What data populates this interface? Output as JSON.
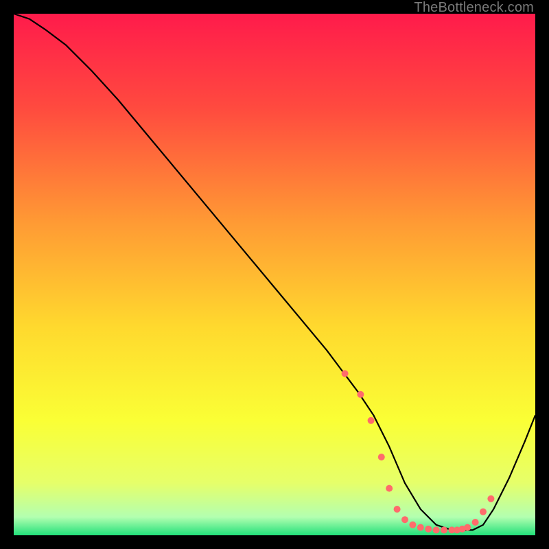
{
  "watermark": "TheBottleneck.com",
  "chart_data": {
    "type": "line",
    "title": "",
    "xlabel": "",
    "ylabel": "",
    "xlim": [
      0,
      100
    ],
    "ylim": [
      0,
      100
    ],
    "grid": false,
    "background_gradient": {
      "stops": [
        {
          "offset": 0.0,
          "color": "#ff1b4b"
        },
        {
          "offset": 0.18,
          "color": "#ff4a3f"
        },
        {
          "offset": 0.4,
          "color": "#ff9a34"
        },
        {
          "offset": 0.6,
          "color": "#ffd92e"
        },
        {
          "offset": 0.78,
          "color": "#faff35"
        },
        {
          "offset": 0.9,
          "color": "#e6ff6a"
        },
        {
          "offset": 0.965,
          "color": "#b3ffb0"
        },
        {
          "offset": 1.0,
          "color": "#22e07a"
        }
      ]
    },
    "series": [
      {
        "name": "bottleneck-curve",
        "color": "#000000",
        "x": [
          0,
          3,
          6,
          10,
          15,
          20,
          25,
          30,
          35,
          40,
          45,
          50,
          55,
          60,
          63,
          66,
          69,
          72,
          75,
          78,
          81,
          84,
          86,
          88,
          90,
          92,
          95,
          98,
          100
        ],
        "y": [
          100,
          99,
          97,
          94,
          89,
          83.5,
          77.5,
          71.5,
          65.5,
          59.5,
          53.5,
          47.5,
          41.5,
          35.5,
          31.5,
          27.5,
          23,
          17,
          10,
          5,
          2,
          1,
          1,
          1,
          2,
          5,
          11,
          18,
          23
        ]
      }
    ],
    "markers": {
      "name": "highlight-dots",
      "color": "#ff6b6b",
      "radius": 5,
      "x": [
        63.5,
        66.5,
        68.5,
        70.5,
        72.0,
        73.5,
        75.0,
        76.5,
        78.0,
        79.5,
        81.0,
        82.5,
        84.0,
        85.0,
        86.0,
        87.0,
        88.5,
        90.0,
        91.5
      ],
      "y": [
        31.0,
        27.0,
        22.0,
        15.0,
        9.0,
        5.0,
        3.0,
        2.0,
        1.5,
        1.2,
        1.0,
        1.0,
        1.0,
        1.0,
        1.2,
        1.5,
        2.5,
        4.5,
        7.0
      ]
    }
  }
}
